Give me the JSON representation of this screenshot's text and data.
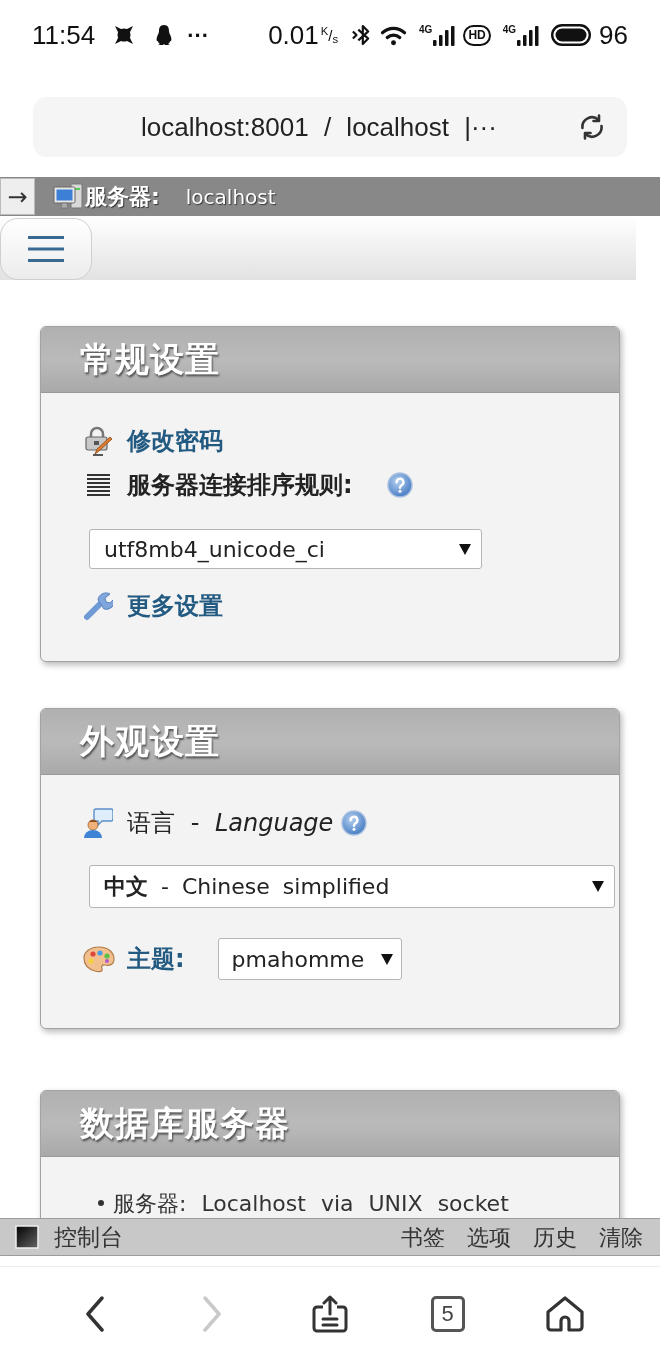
{
  "status_bar": {
    "time": "11:54",
    "more_notifications": "···",
    "network_speed": "0.01",
    "speed_unit": "$^{K}$/$_{s}$",
    "network_types": [
      "4G",
      "4G"
    ],
    "hd_label": "HD",
    "battery_percent": "96"
  },
  "address_bar": {
    "text": "localhost:8001 / localhost |···"
  },
  "breadcrumb": {
    "toggle": "→",
    "label": "服务器:",
    "value": "localhost"
  },
  "panels": [
    {
      "kind": "general",
      "title": "常规设置",
      "change_password": "修改密码",
      "collation_label": "服务器连接排序规则:",
      "collation_value": "utf8mb4_unicode_ci",
      "more_settings": "更多设置"
    },
    {
      "kind": "appearance",
      "title": "外观设置",
      "language_label": "语言 - *Language*",
      "language_value": "**中文** - Chinese simplified",
      "theme_label": "主题:",
      "theme_value": "pmahomme"
    },
    {
      "kind": "database_server",
      "title": "数据库服务器",
      "items": [
        "服务器: Localhost via UNIX socket"
      ]
    }
  ],
  "console_bar": {
    "title": "控制台",
    "actions": [
      "书签",
      "选项",
      "历史",
      "清除"
    ]
  },
  "nav_bar": {
    "buttons": [
      {
        "kind": "back",
        "disabled": false
      },
      {
        "kind": "forward",
        "disabled": true
      },
      {
        "kind": "share",
        "disabled": false
      },
      {
        "kind": "tabs",
        "count": "5",
        "disabled": false
      },
      {
        "kind": "home",
        "disabled": false
      }
    ]
  }
}
